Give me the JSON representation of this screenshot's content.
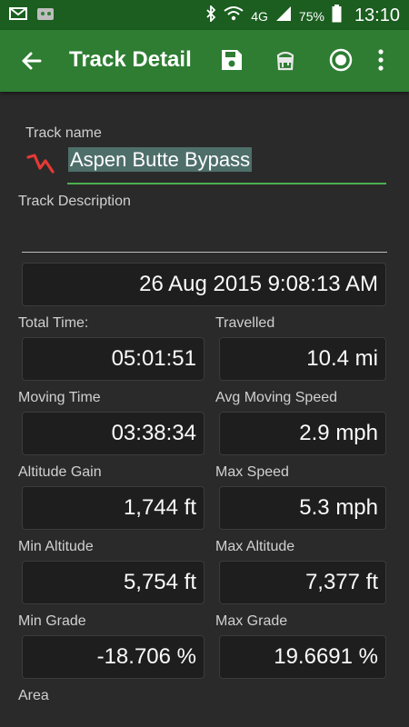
{
  "status_bar": {
    "battery": "75%",
    "network": "4G",
    "time": "13:10"
  },
  "app_bar": {
    "title": "Track Detail"
  },
  "track": {
    "name_label": "Track name",
    "name_value": "Aspen Butte Bypass",
    "description_label": "Track Description",
    "description_value": "",
    "date": "26 Aug 2015 9:08:13 AM"
  },
  "stats": {
    "total_time_label": "Total Time:",
    "total_time_value": "05:01:51",
    "travelled_label": "Travelled",
    "travelled_value": "10.4 mi",
    "moving_time_label": "Moving Time",
    "moving_time_value": "03:38:34",
    "avg_speed_label": "Avg Moving Speed",
    "avg_speed_value": "2.9 mph",
    "alt_gain_label": "Altitude Gain",
    "alt_gain_value": "1,744 ft",
    "max_speed_label": "Max Speed",
    "max_speed_value": "5.3 mph",
    "min_alt_label": "Min Altitude",
    "min_alt_value": "5,754 ft",
    "max_alt_label": "Max Altitude",
    "max_alt_value": "7,377 ft",
    "min_grade_label": "Min Grade",
    "min_grade_value": "-18.706 %",
    "max_grade_label": "Max Grade",
    "max_grade_value": "19.6691 %",
    "area_label": "Area"
  },
  "icons": {
    "back": "arrow-back-icon",
    "save": "save-icon",
    "paint": "paint-bucket-icon",
    "record": "record-icon",
    "overflow": "more-vert-icon",
    "track_type": "track-line-icon"
  },
  "colors": {
    "status_bar": "#1b5e20",
    "app_bar": "#2e7d32",
    "background": "#2a2a2a",
    "accent_line": "#4caf50",
    "track_icon": "#e53935"
  }
}
